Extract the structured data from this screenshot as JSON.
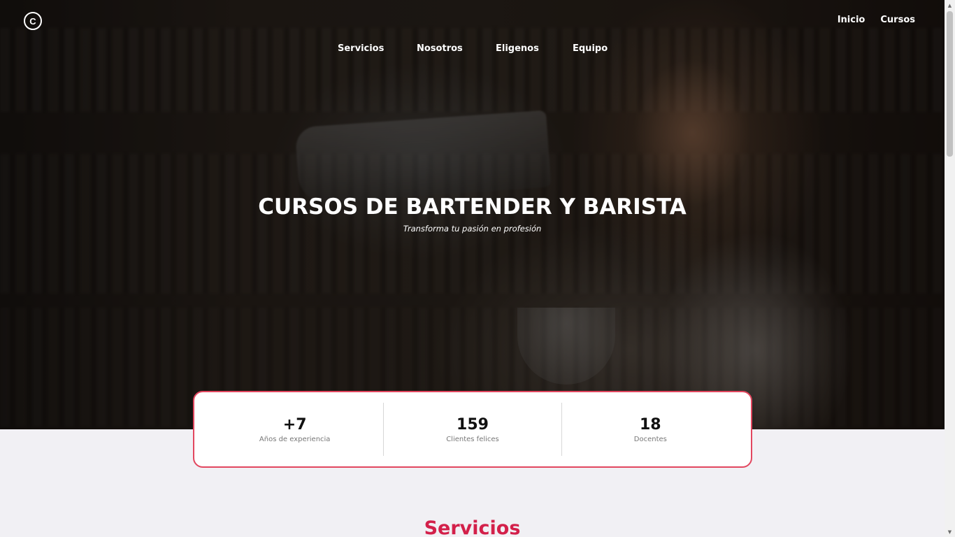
{
  "logo": {
    "glyph": "C"
  },
  "top_nav": [
    {
      "label": "Inicio"
    },
    {
      "label": "Cursos"
    }
  ],
  "main_nav": [
    {
      "label": "Servicios"
    },
    {
      "label": "Nosotros"
    },
    {
      "label": "Eligenos"
    },
    {
      "label": "Equipo"
    }
  ],
  "hero": {
    "title": "CURSOS DE BARTENDER Y BARISTA",
    "subtitle": "Transforma tu pasión en profesión"
  },
  "stats": [
    {
      "value": "+7",
      "label": "Años de experiencia"
    },
    {
      "value": "159",
      "label": "Clientes felices"
    },
    {
      "value": "18",
      "label": "Docentes"
    }
  ],
  "services": {
    "title": "Servicios"
  },
  "colors": {
    "accent": "#d3204a",
    "card_border": "#e2475f",
    "page_background": "#f1f0f4"
  },
  "scrollbar": {
    "up_icon": "▲",
    "down_icon": "▼"
  }
}
